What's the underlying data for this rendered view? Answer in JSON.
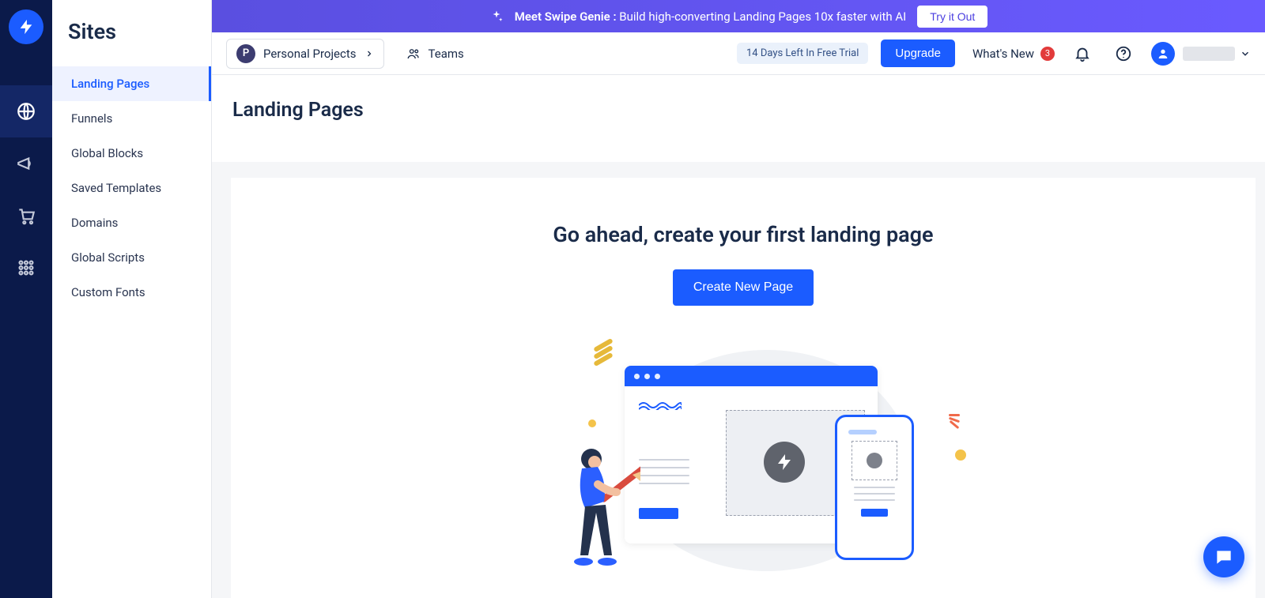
{
  "sidebar": {
    "title": "Sites",
    "items": [
      {
        "label": "Landing Pages",
        "active": true
      },
      {
        "label": "Funnels"
      },
      {
        "label": "Global Blocks"
      },
      {
        "label": "Saved Templates"
      },
      {
        "label": "Domains"
      },
      {
        "label": "Global Scripts"
      },
      {
        "label": "Custom Fonts"
      }
    ]
  },
  "promo": {
    "strong": "Meet Swipe Genie :",
    "rest": " Build high-converting Landing Pages 10x faster with AI",
    "button": "Try it Out"
  },
  "header": {
    "project_badge": "P",
    "project_name": "Personal Projects",
    "teams_label": "Teams",
    "trial_text": "14 Days Left In Free Trial",
    "upgrade_label": "Upgrade",
    "whatsnew_label": "What's New",
    "whatsnew_count": "3"
  },
  "page": {
    "heading": "Landing Pages"
  },
  "empty": {
    "title": "Go ahead, create your first landing page",
    "button": "Create New Page"
  }
}
